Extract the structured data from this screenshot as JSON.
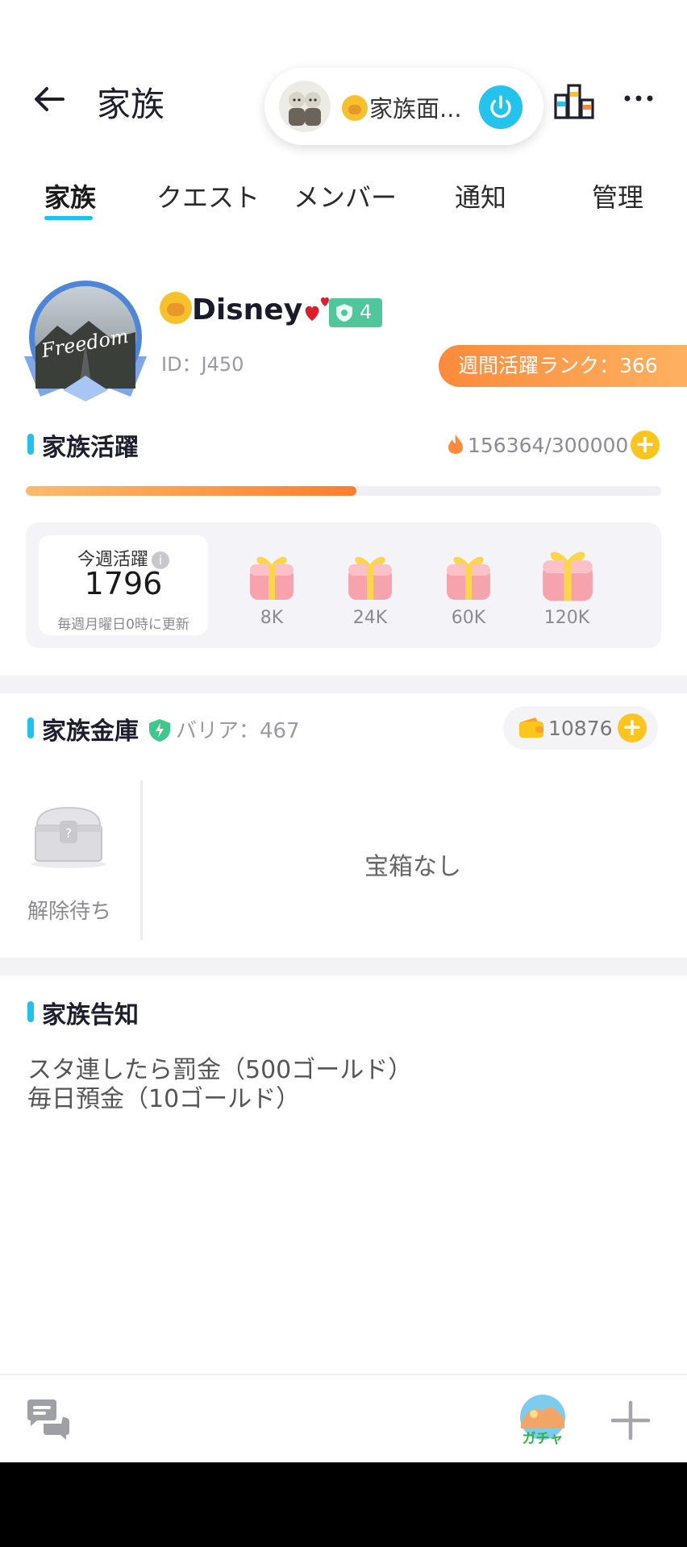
{
  "header": {
    "title": "家族",
    "room_name": "家族面...",
    "icons": {
      "back": "arrow-left-icon",
      "power": "power-icon",
      "rank": "ranking-bars-icon",
      "more": "more-dots-icon"
    }
  },
  "tabs": [
    {
      "label": "家族",
      "active": true
    },
    {
      "label": "クエスト",
      "active": false
    },
    {
      "label": "メンバー",
      "active": false
    },
    {
      "label": "通知",
      "active": false
    },
    {
      "label": "管理",
      "active": false
    }
  ],
  "profile": {
    "avatar_text": "Freedom",
    "name": "Disney",
    "level": "4",
    "id": "ID：J450",
    "weekly_rank": "週間活躍ランク：366"
  },
  "activity": {
    "title": "家族活躍",
    "value": "156364/300000",
    "progress": 0.52,
    "weekly_label": "今週活躍",
    "weekly_value": "1796",
    "weekly_note": "毎週月曜日0時に更新",
    "rewards": [
      "8K",
      "24K",
      "60K",
      "120K"
    ]
  },
  "vault": {
    "title": "家族金庫",
    "barrier": "バリア：467",
    "gold": "10876",
    "chest_status": "解除待ち",
    "empty_text": "宝箱なし"
  },
  "notice": {
    "title": "家族告知",
    "lines": [
      "スタ連したら罰金（500ゴールド）",
      "毎日預金（10ゴールド）"
    ]
  },
  "bottom": {
    "gacha_label": "ガチャ",
    "icons": {
      "chat": "chat-bubbles-icon",
      "gacha": "gacha-icon",
      "plus": "plus-icon"
    }
  },
  "colors": {
    "accent": "#1ec0ec",
    "orange": "#fb8a3c",
    "gold": "#fbc51d",
    "level_green": "#4fc79a"
  }
}
